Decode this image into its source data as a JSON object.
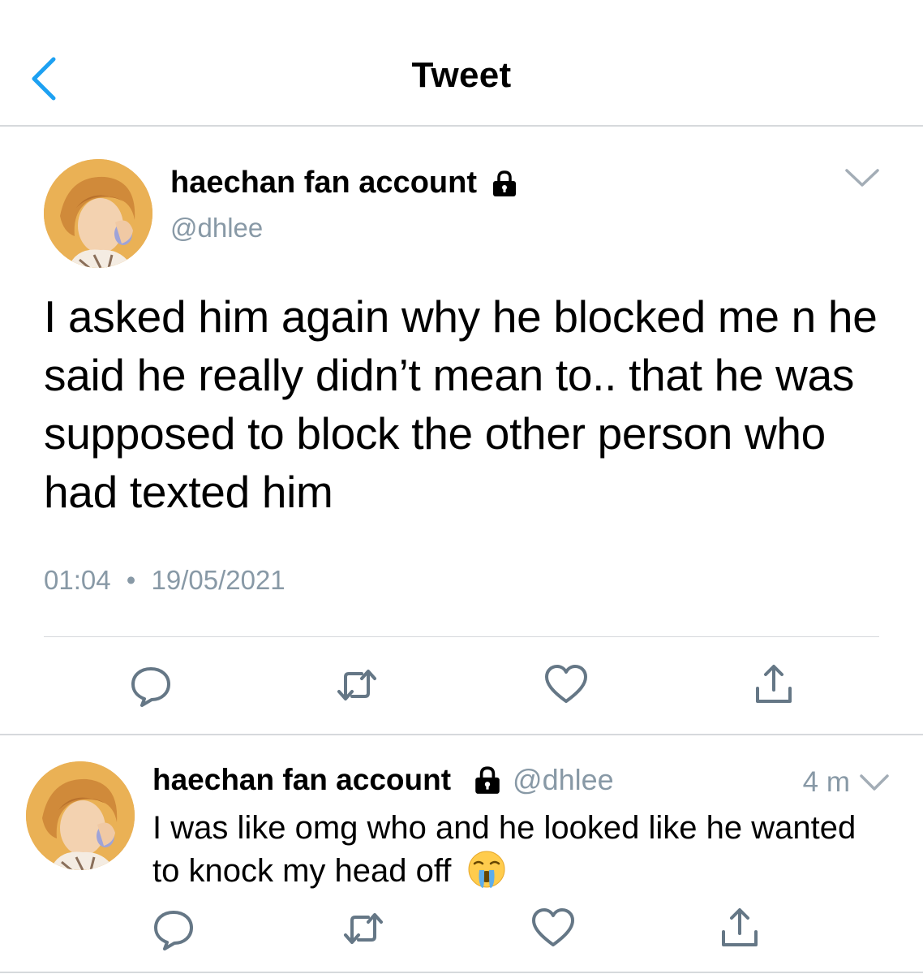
{
  "nav": {
    "title": "Tweet",
    "back_icon": "chevron-left-icon"
  },
  "main_tweet": {
    "author_name": "haechan fan account",
    "author_handle": "@dhlee",
    "protected_icon": "lock-icon",
    "text": "I asked him again why he blocked me n he said he really didn’t mean to.. that he was supposed to block the other person who had texted him",
    "time": "01:04",
    "separator": "•",
    "date": "19/05/2021",
    "actions": [
      "reply-icon",
      "retweet-icon",
      "like-icon",
      "share-icon"
    ]
  },
  "reply_tweet": {
    "author_name": "haechan fan account",
    "author_handle": "@dhlee",
    "time_ago": "4 m",
    "text": "I was like omg who and he looked like he wanted to knock my head off",
    "emoji": "loudly-crying-face-emoji",
    "actions": [
      "reply-icon",
      "retweet-icon",
      "like-icon",
      "share-icon"
    ]
  },
  "colors": {
    "accent": "#1da1f2",
    "muted": "#8899a6",
    "icon_gray": "#657786",
    "divider": "#d6d9dc"
  }
}
